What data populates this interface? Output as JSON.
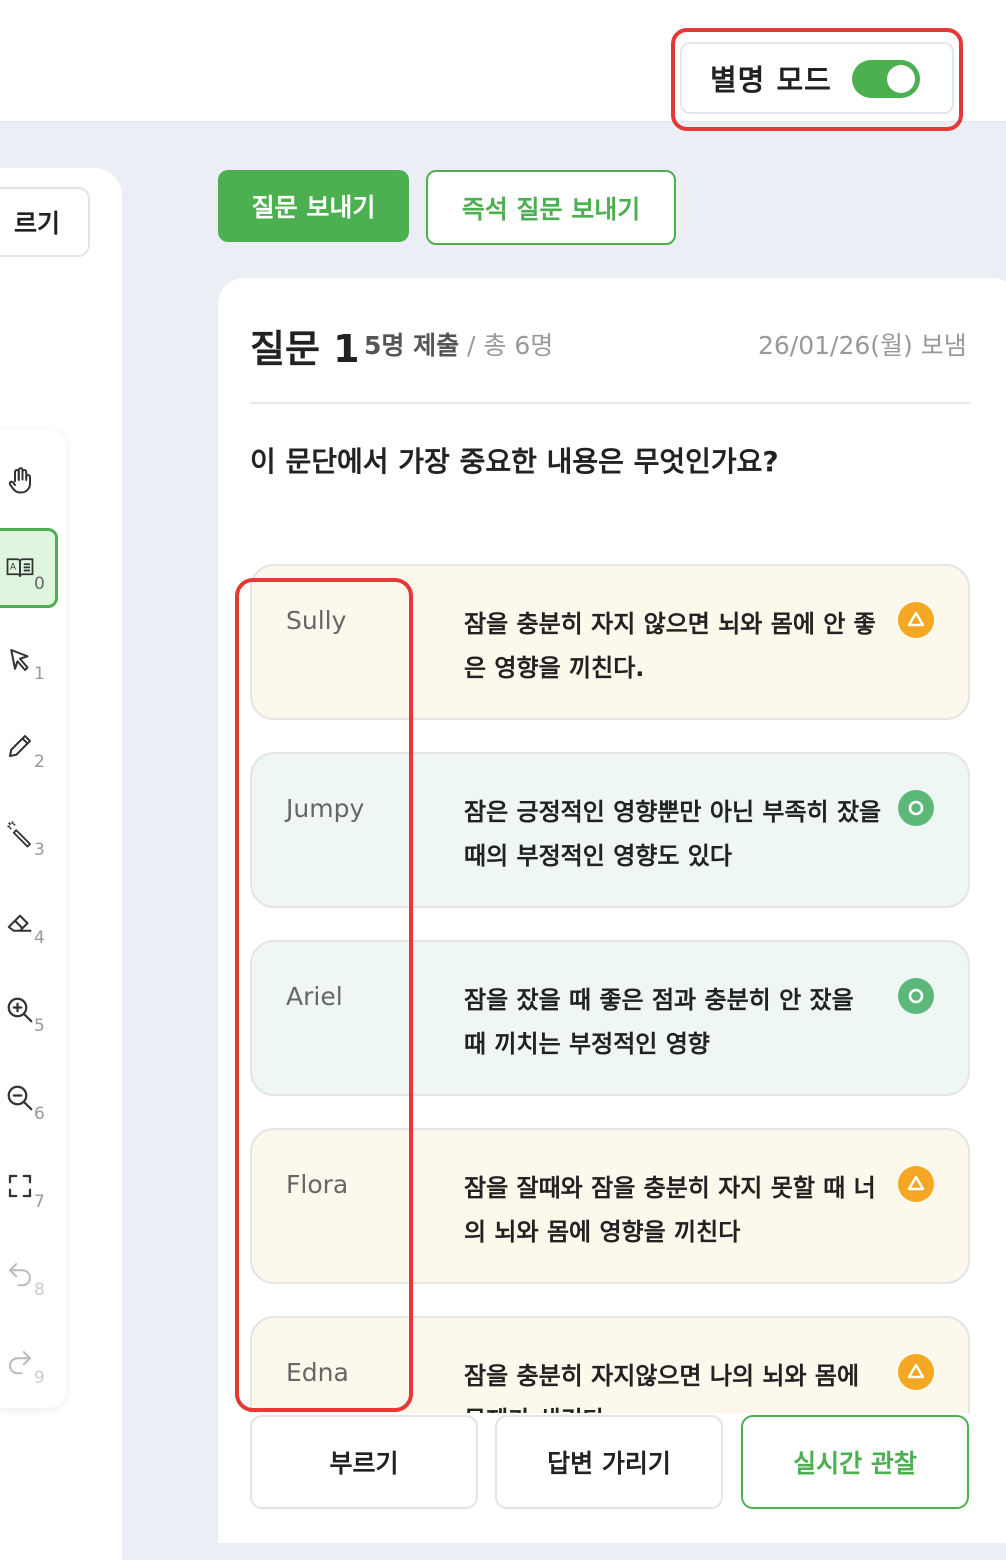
{
  "header": {
    "alias_mode_label": "별명 모드",
    "alias_mode_on": true
  },
  "left": {
    "partial_button_label": "르기"
  },
  "toolbar": {
    "tools": [
      {
        "icon": "hand-icon",
        "number": ""
      },
      {
        "icon": "book-icon",
        "number": "0"
      },
      {
        "icon": "pointer-icon",
        "number": "1"
      },
      {
        "icon": "pencil-icon",
        "number": "2"
      },
      {
        "icon": "magic-pen-icon",
        "number": "3"
      },
      {
        "icon": "eraser-icon",
        "number": "4"
      },
      {
        "icon": "zoom-in-icon",
        "number": "5"
      },
      {
        "icon": "zoom-out-icon",
        "number": "6"
      },
      {
        "icon": "fullscreen-icon",
        "number": "7"
      },
      {
        "icon": "undo-icon",
        "number": "8"
      },
      {
        "icon": "redo-icon",
        "number": "9"
      }
    ]
  },
  "actions": {
    "send_question": "질문 보내기",
    "send_instant_question": "즉석 질문 보내기"
  },
  "question": {
    "title": "질문 1",
    "submitted": "5명 제출",
    "total": " / 총 6명",
    "date": "26/01/26(월) 보냄",
    "text": "이 문단에서 가장 중요한 내용은 무엇인가요?"
  },
  "answers": [
    {
      "name": "Sully",
      "text": "잠을 충분히 자지 않으면 뇌와 몸에 안 좋은 영향을 끼친다.",
      "status": "warn",
      "status_icon": "triangle-icon"
    },
    {
      "name": "Jumpy",
      "text": "잠은 긍정적인 영향뿐만 아닌 부족히 잤을때의 부정적인 영향도 있다",
      "status": "ok",
      "status_icon": "circle-icon"
    },
    {
      "name": "Ariel",
      "text": "잠을 잤을 때 좋은 점과 충분히 안 잤을 때 끼치는 부정적인 영향",
      "status": "ok",
      "status_icon": "circle-icon"
    },
    {
      "name": "Flora",
      "text": "잠을 잘때와 잠을 충분히 자지 못할 때 너의 뇌와 몸에 영향을 끼친다",
      "status": "warn",
      "status_icon": "triangle-icon"
    },
    {
      "name": "Edna",
      "text": "잠을 충분히 자지않으면 나의 뇌와 몸에 문제가 생긴다",
      "status": "warn",
      "status_icon": "triangle-icon"
    }
  ],
  "bottom": {
    "call": "부르기",
    "hide_answers": "답변 가리기",
    "live_observe": "실시간 관찰"
  },
  "colors": {
    "accent": "#4caf50",
    "warn": "#f5a623",
    "ok": "#5cb87a",
    "highlight": "#e53935"
  }
}
